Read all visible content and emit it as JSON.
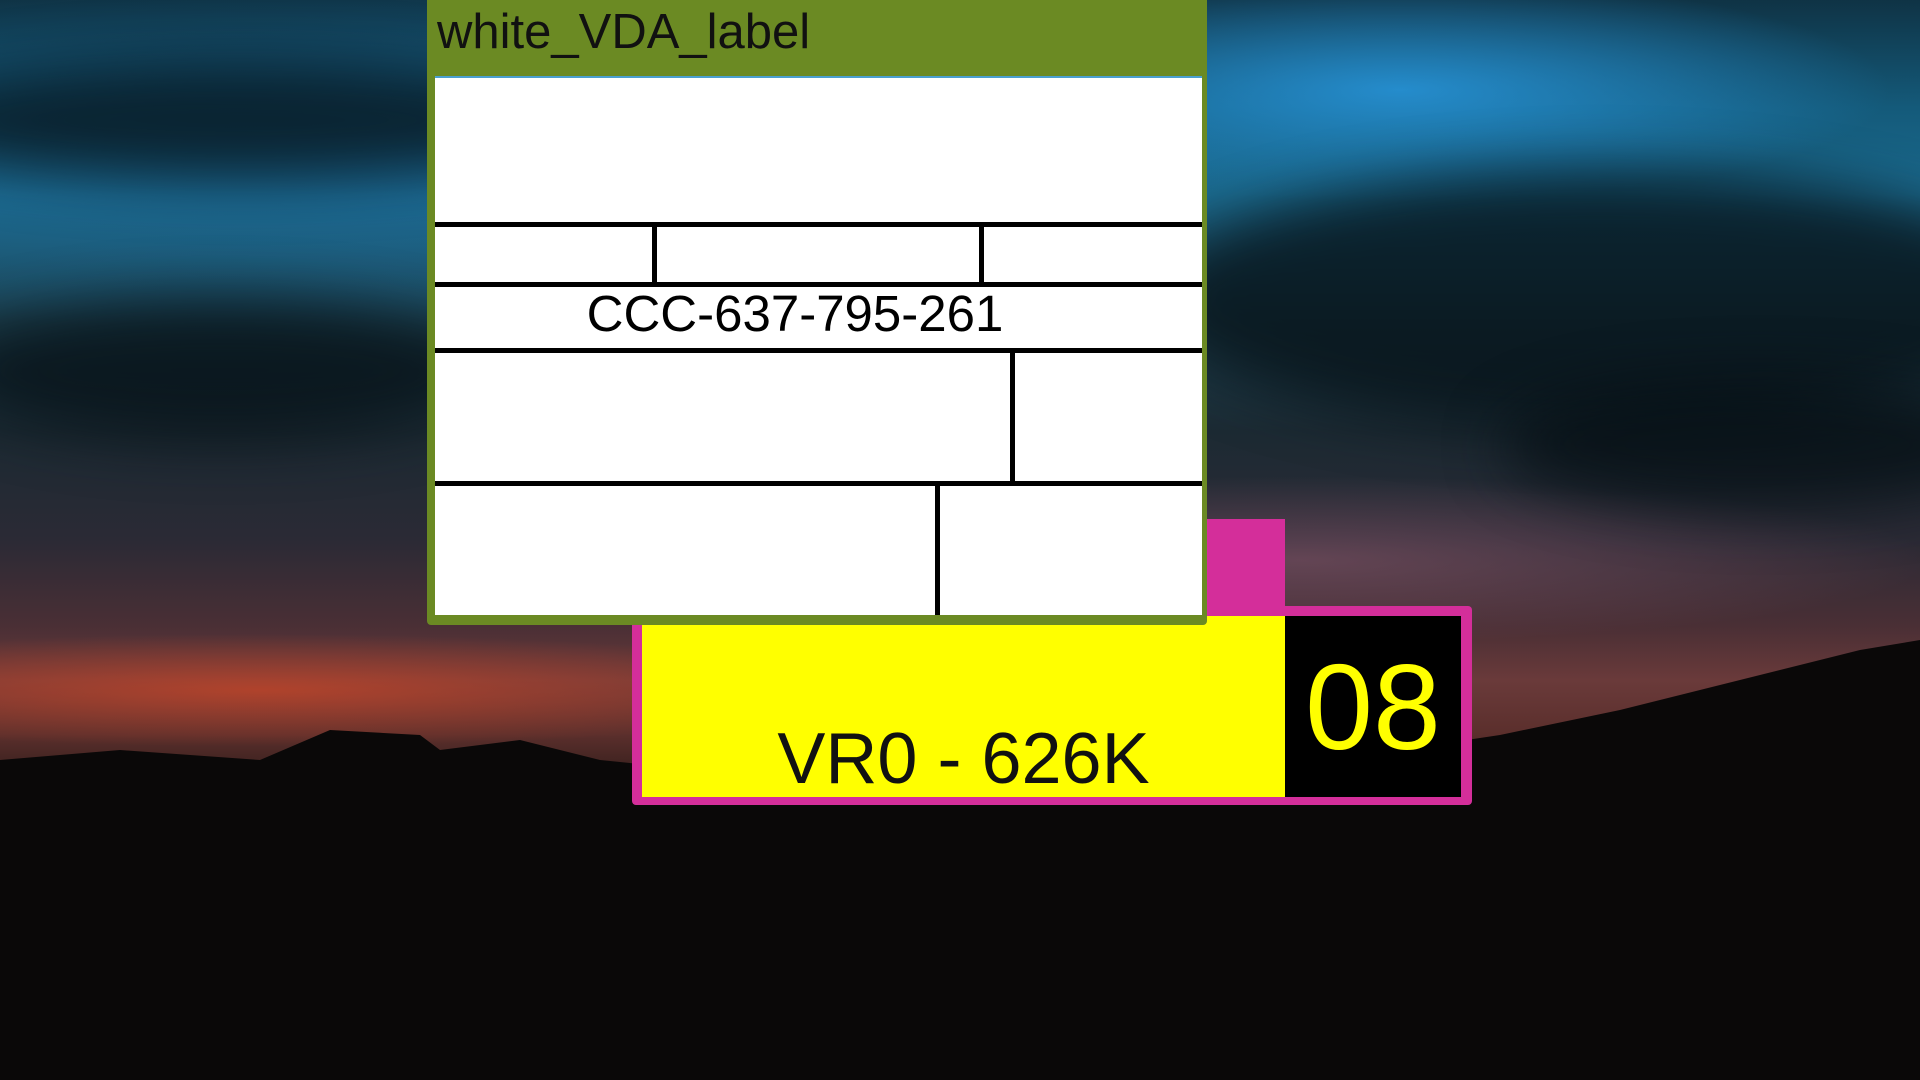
{
  "vda_label": {
    "title": "white_VDA_label",
    "code": "CCC-637-795-261"
  },
  "plate": {
    "registration": "VR0 - 626K",
    "number": "08"
  },
  "colors": {
    "panel_green": "#6b8a23",
    "plate_magenta": "#d42e9a",
    "plate_yellow": "#ffff00",
    "plate_black": "#000000"
  }
}
